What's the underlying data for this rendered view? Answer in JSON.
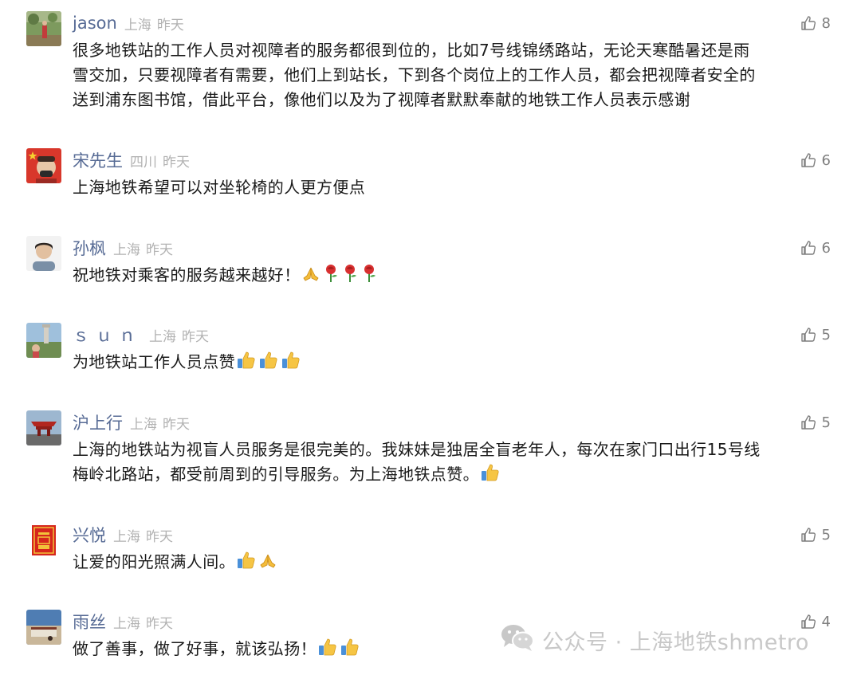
{
  "comments": [
    {
      "nickname": "jason",
      "location": "上海",
      "time": "昨天",
      "likes": "8",
      "lines": [
        "很多地铁站的工作人员对视障者的服务都很到位的，比如7号线锦绣路站，无论天寒酷暑还是雨",
        "雪交加，只要视障者有需要，他们上到站长，下到各个岗位上的工作人员，都会把视障者安全的",
        "送到浦东图书馆，借此平台，像他们以及为了视障者默默奉献的地铁工作人员表示感谢"
      ]
    },
    {
      "nickname": "宋先生",
      "location": "四川",
      "time": "昨天",
      "likes": "6",
      "lines": [
        "上海地铁希望可以对坐轮椅的人更方便点"
      ]
    },
    {
      "nickname": "孙枫",
      "location": "上海",
      "time": "昨天",
      "likes": "6",
      "lines": [
        "祝地铁对乘客的服务越来越好！"
      ],
      "emoji": [
        "pray-emoji",
        "rose-emoji",
        "rose-emoji",
        "rose-emoji"
      ]
    },
    {
      "nickname": "ｓｕｎ",
      "location": "上海",
      "time": "昨天",
      "likes": "5",
      "lines": [
        "为地铁站工作人员点赞"
      ],
      "emoji": [
        "thumbs-up-emoji",
        "thumbs-up-emoji",
        "thumbs-up-emoji"
      ]
    },
    {
      "nickname": "沪上行",
      "location": "上海",
      "time": "昨天",
      "likes": "5",
      "lines": [
        "上海的地铁站为视盲人员服务是很完美的。我妹妹是独居全盲老年人，每次在家门口出行15号线",
        "梅岭北路站，都受前周到的引导服务。为上海地铁点赞。"
      ],
      "emoji": [
        "thumbs-up-emoji"
      ]
    },
    {
      "nickname": "兴悦",
      "location": "上海",
      "time": "昨天",
      "likes": "5",
      "lines": [
        "让爱的阳光照满人间。"
      ],
      "emoji": [
        "thumbs-up-emoji",
        "pray-emoji"
      ]
    },
    {
      "nickname": "雨丝",
      "location": "上海",
      "time": "昨天",
      "likes": "4",
      "lines": [
        "做了善事，做了好事，就该弘扬！"
      ],
      "emoji": [
        "thumbs-up-emoji",
        "thumbs-up-emoji"
      ]
    }
  ],
  "watermark": {
    "text": "公众号 · 上海地铁shmetro",
    "icon": "wechat-icon"
  },
  "colors": {
    "nickname": "#576b95",
    "meta": "#b2b2b2",
    "body_text": "#1a1a1a",
    "like": "#7f7f7f",
    "watermark": "#c8c8c8"
  }
}
